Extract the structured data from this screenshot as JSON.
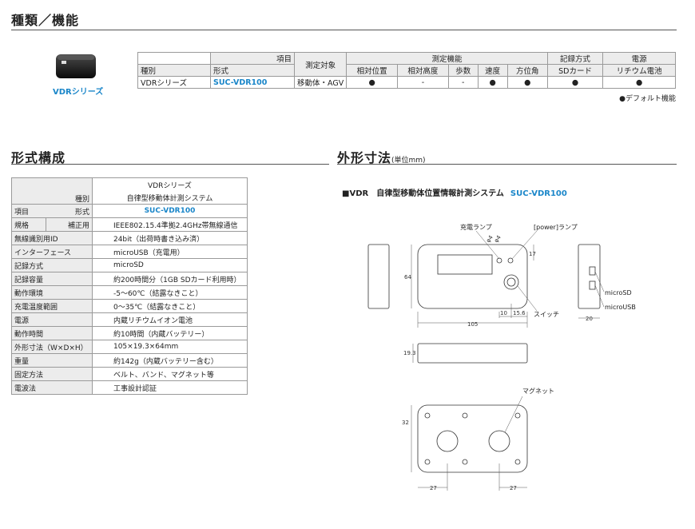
{
  "sections": {
    "type_title": "種類／機能",
    "composition_title": "形式構成",
    "dimension_title": "外形寸法",
    "dimension_unit": "(単位mm)"
  },
  "product": {
    "caption": "VDRシリーズ",
    "photo_icon": "vdr-device-photo"
  },
  "type_table": {
    "h_item": "項目",
    "h_measure_target": "測定対象",
    "h_measure_func": "測定機能",
    "h_record": "記録方式",
    "h_power": "電源",
    "h_type": "種別",
    "h_model": "形式",
    "h_functions": [
      "相対位置",
      "相対高度",
      "歩数",
      "速度",
      "方位角"
    ],
    "h_record_sub": "SDカード",
    "h_power_sub": "リチウム電池",
    "row": {
      "type": "VDRシリーズ",
      "model": "SUC-VDR100",
      "target": "移動体・AGV",
      "functions": [
        "●",
        "-",
        "-",
        "●",
        "●"
      ],
      "record": "●",
      "power": "●"
    }
  },
  "default_note": "●デフォルト機能",
  "spec_table": {
    "header_series": "VDRシリーズ",
    "header_system": "自律型移動体計測システム",
    "h_type": "種別",
    "h_item": "項目",
    "h_model": "形式",
    "model": "SUC-VDR100",
    "h_standard": "規格",
    "h_correction": "補正用",
    "standard_value": "IEEE802.15.4準拠2.4GHz帯無線通信",
    "rows": [
      {
        "label": "無線識別用ID",
        "value": "24bit（出荷時書き込み済）"
      },
      {
        "label": "インターフェース",
        "value": "microUSB（充電用）"
      },
      {
        "label": "記録方式",
        "value": "microSD"
      },
      {
        "label": "記録容量",
        "value": "約200時間分（1GB SDカード利用時）"
      },
      {
        "label": "動作環境",
        "value": "-5〜60℃（結露なきこと）"
      },
      {
        "label": "充電温度範囲",
        "value": "0〜35℃（結露なきこと）"
      },
      {
        "label": "電源",
        "value": "内蔵リチウムイオン電池"
      },
      {
        "label": "動作時間",
        "value": "約10時間（内蔵バッテリー）"
      },
      {
        "label": "外形寸法（W×D×H）",
        "value": "105×19.3×64mm"
      },
      {
        "label": "重量",
        "value": "約142g（内蔵バッテリー含む）"
      },
      {
        "label": "固定方法",
        "value": "ベルト、バンド、マグネット等"
      },
      {
        "label": "電波法",
        "value": "工事設計認証"
      }
    ]
  },
  "diagram": {
    "title": "■VDR　自律型移動体位置情報計測システム",
    "model": "SUC-VDR100",
    "labels": {
      "charge_lamp": "充電ランプ",
      "power_lamp": "[power]ランプ",
      "switch": "スイッチ",
      "microsd": "microSD",
      "microusb": "microUSB",
      "magnet": "マグネット"
    },
    "dims": {
      "phi1": "φ4",
      "phi2": "φ4",
      "d17": "17",
      "d64": "64",
      "d10": "10",
      "d15_6": "15.6",
      "d105": "105",
      "d20": "20",
      "d19_3": "19.3",
      "d32": "32",
      "d27a": "27",
      "d27b": "27"
    }
  }
}
